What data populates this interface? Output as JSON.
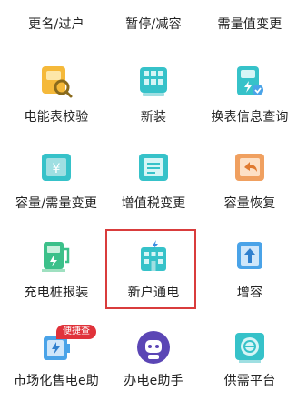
{
  "grid": {
    "row0": [
      "更名/过户",
      "暂停/减容",
      "需量值变更"
    ],
    "row1": [
      "电能表校验",
      "新装",
      "换表信息查询"
    ],
    "row2": [
      "容量/需量变更",
      "增值税变更",
      "容量恢复"
    ],
    "row3": [
      "充电桩报装",
      "新户通电",
      "增容"
    ],
    "row4": [
      "市场化售电e助",
      "办电e助手",
      "供需平台"
    ]
  },
  "badge": "便捷查",
  "icons": {
    "row1": [
      "meter-search-icon",
      "grid-panel-icon",
      "meter-check-icon"
    ],
    "row2": [
      "yen-box-icon",
      "tax-doc-icon",
      "restore-arrow-icon"
    ],
    "row3": [
      "charging-pile-icon",
      "building-power-icon",
      "upload-arrow-icon"
    ],
    "row4": [
      "battery-box-icon",
      "robot-assistant-icon",
      "supply-platform-icon"
    ]
  },
  "colors": {
    "highlight": "#d93c3c",
    "badge": "#e0323a",
    "yellow": "#f5b93a",
    "teal": "#36c2c9",
    "orange": "#f0a060",
    "blue": "#4aa3e8",
    "green": "#3cc08a",
    "purple": "#5b46b5"
  }
}
